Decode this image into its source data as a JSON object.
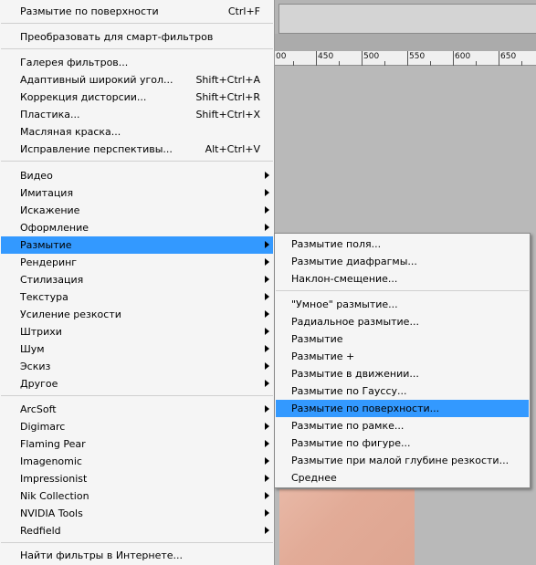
{
  "filter_menu": {
    "group1": [
      {
        "label": "Размытие по поверхности",
        "shortcut": "Ctrl+F"
      }
    ],
    "group2": [
      {
        "label": "Преобразовать для смарт-фильтров"
      }
    ],
    "group3": [
      {
        "label": "Галерея фильтров..."
      },
      {
        "label": "Адаптивный широкий угол...",
        "shortcut": "Shift+Ctrl+A"
      },
      {
        "label": "Коррекция дисторсии...",
        "shortcut": "Shift+Ctrl+R"
      },
      {
        "label": "Пластика...",
        "shortcut": "Shift+Ctrl+X"
      },
      {
        "label": "Масляная краска..."
      },
      {
        "label": "Исправление перспективы...",
        "shortcut": "Alt+Ctrl+V"
      }
    ],
    "group4": [
      {
        "label": "Видео"
      },
      {
        "label": "Имитация"
      },
      {
        "label": "Искажение"
      },
      {
        "label": "Оформление"
      },
      {
        "label": "Размытие"
      },
      {
        "label": "Рендеринг"
      },
      {
        "label": "Стилизация"
      },
      {
        "label": "Текстура"
      },
      {
        "label": "Усиление резкости"
      },
      {
        "label": "Штрихи"
      },
      {
        "label": "Шум"
      },
      {
        "label": "Эскиз"
      },
      {
        "label": "Другое"
      }
    ],
    "group5": [
      {
        "label": "ArcSoft"
      },
      {
        "label": "Digimarc"
      },
      {
        "label": "Flaming Pear"
      },
      {
        "label": "Imagenomic"
      },
      {
        "label": "Impressionist"
      },
      {
        "label": "Nik Collection"
      },
      {
        "label": "NVIDIA Tools"
      },
      {
        "label": "Redfield"
      }
    ],
    "group6": [
      {
        "label": "Найти фильтры в Интернете..."
      }
    ],
    "highlighted": "Размытие"
  },
  "blur_submenu": {
    "group1": [
      {
        "label": "Размытие поля..."
      },
      {
        "label": "Размытие диафрагмы..."
      },
      {
        "label": "Наклон-смещение..."
      }
    ],
    "group2": [
      {
        "label": "\"Умное\" размытие..."
      },
      {
        "label": "Радиальное размытие..."
      },
      {
        "label": "Размытие"
      },
      {
        "label": "Размытие +"
      },
      {
        "label": "Размытие в движении..."
      },
      {
        "label": "Размытие по Гауссу..."
      },
      {
        "label": "Размытие по поверхности..."
      },
      {
        "label": "Размытие по рамке..."
      },
      {
        "label": "Размытие по фигуре..."
      },
      {
        "label": "Размытие при малой глубине резкости..."
      },
      {
        "label": "Среднее"
      }
    ],
    "highlighted": "Размытие по поверхности..."
  },
  "ruler": {
    "labels": [
      "00",
      "450",
      "500",
      "550",
      "600",
      "650"
    ]
  },
  "colors": {
    "highlight": "#3399ff",
    "menu_bg": "#f5f5f5"
  }
}
